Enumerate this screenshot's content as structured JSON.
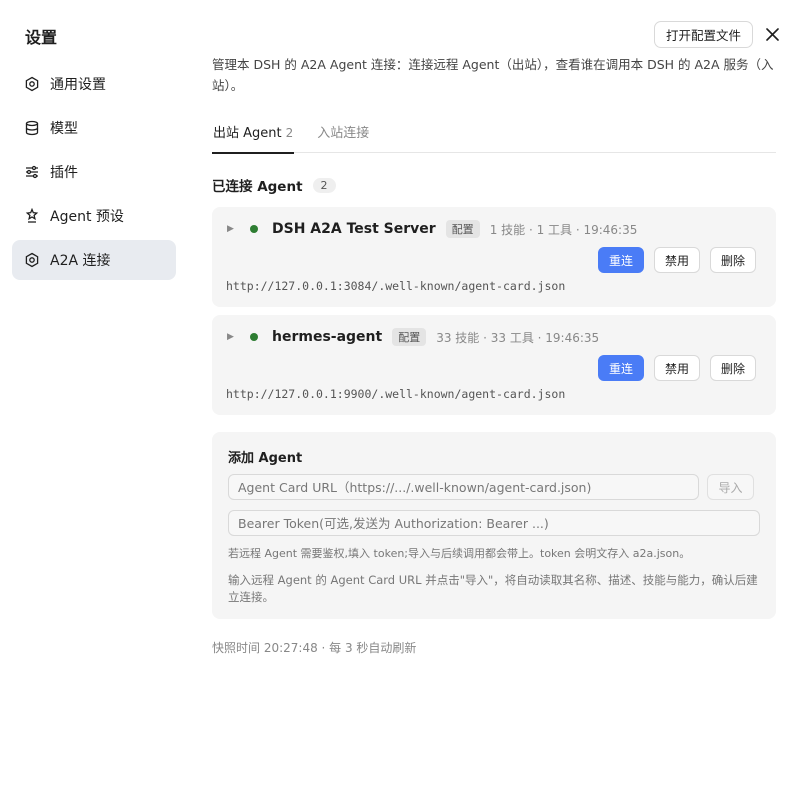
{
  "sidebar": {
    "title": "设置",
    "items": [
      {
        "label": "通用设置",
        "icon": "gear-icon"
      },
      {
        "label": "模型",
        "icon": "database-icon"
      },
      {
        "label": "插件",
        "icon": "sliders-icon"
      },
      {
        "label": "Agent 预设",
        "icon": "agent-icon"
      },
      {
        "label": "A2A 连接",
        "icon": "gear-icon",
        "active": true
      }
    ]
  },
  "header": {
    "open_config_label": "打开配置文件",
    "close_icon": "close-icon"
  },
  "main": {
    "description": "管理本 DSH 的 A2A Agent 连接：连接远程 Agent（出站），查看谁在调用本 DSH 的 A2A 服务（入站）。",
    "tabs": [
      {
        "label": "出站 Agent",
        "count": "2",
        "active": true
      },
      {
        "label": "入站连接",
        "count": ""
      }
    ],
    "connected_heading": "已连接 Agent",
    "connected_count": "2",
    "agents": [
      {
        "name": "DSH A2A Test Server",
        "tag": "配置",
        "meta": "1 技能 · 1 工具 · 19:46:35",
        "url": "http://127.0.0.1:3084/.well-known/agent-card.json",
        "status_color": "#2e7d32",
        "reconnect_label": "重连",
        "disable_label": "禁用",
        "delete_label": "删除"
      },
      {
        "name": "hermes-agent",
        "tag": "配置",
        "meta": "33 技能 · 33 工具 · 19:46:35",
        "url": "http://127.0.0.1:9900/.well-known/agent-card.json",
        "status_color": "#2e7d32",
        "reconnect_label": "重连",
        "disable_label": "禁用",
        "delete_label": "删除"
      }
    ],
    "add": {
      "title": "添加 Agent",
      "url_placeholder": "Agent Card URL（https://.../.well-known/agent-card.json)",
      "import_label": "导入",
      "token_placeholder": "Bearer Token(可选,发送为 Authorization: Bearer ...)",
      "hint1": "若远程 Agent 需要鉴权,填入 token;导入与后续调用都会带上。token 会明文存入 a2a.json。",
      "hint2": "输入远程 Agent 的 Agent Card URL 并点击\"导入\"，将自动读取其名称、描述、技能与能力，确认后建立连接。"
    },
    "snapshot": "快照时间 20:27:48 · 每 3 秒自动刷新"
  },
  "colors": {
    "accent": "#4a7cf6",
    "status_online": "#2e7d32",
    "active_nav_bg": "#e8ebf0"
  }
}
